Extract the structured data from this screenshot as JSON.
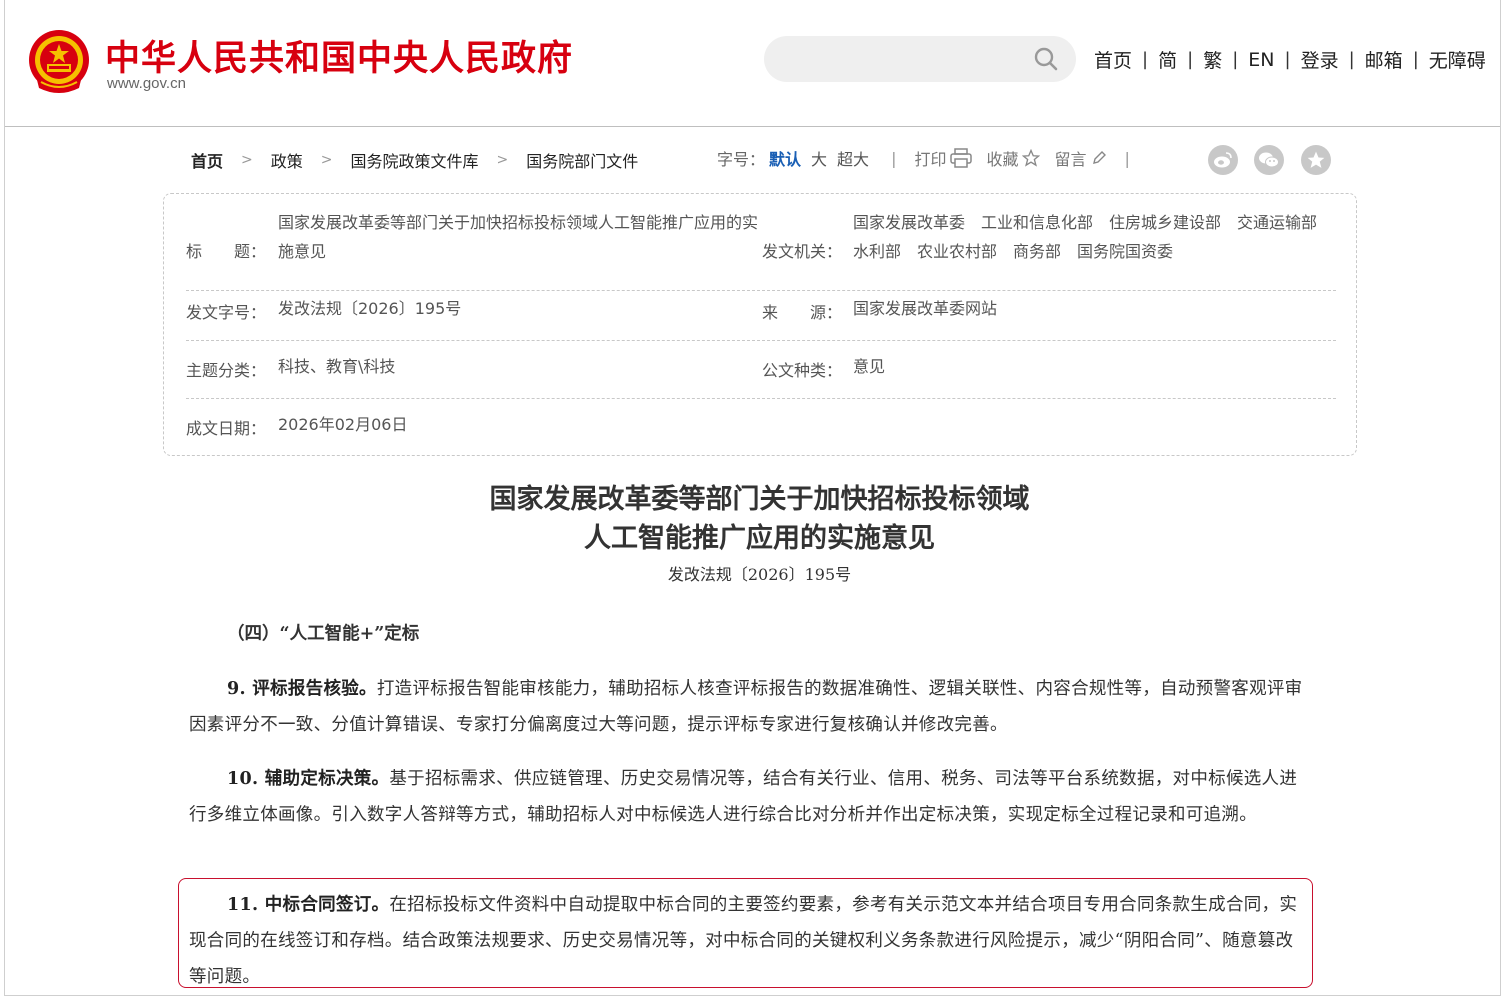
{
  "header": {
    "site_title": "中华人民共和国中央人民政府",
    "site_domain": "www.gov.cn",
    "search_placeholder": "",
    "nav": [
      "首页",
      "简",
      "繁",
      "EN",
      "登录",
      "邮箱",
      "无障碍"
    ],
    "colors": {
      "brand_red": "#d7000f",
      "link_blue": "#1a5fb4",
      "highlight_border": "#c8102e"
    }
  },
  "breadcrumb": [
    "首页",
    "政策",
    "国务院政策文件库",
    "国务院部门文件"
  ],
  "tools": {
    "font_size_label": "字号：",
    "font_sizes": [
      "默认",
      "大",
      "超大"
    ],
    "active_font_size": "默认",
    "print": "打印",
    "favorite": "收藏",
    "comment": "留言",
    "share_icons": [
      "weibo-icon",
      "wechat-icon",
      "qzone-icon"
    ]
  },
  "info": {
    "title_label": "标　　题：",
    "title_value": "国家发展改革委等部门关于加快招标投标领域人工智能推广应用的实施意见",
    "issuer_label": "发文机关：",
    "issuer_value": "国家发展改革委　工业和信息化部　住房城乡建设部　交通运输部　水利部　农业农村部　商务部　国务院国资委",
    "doc_no_label": "发文字号：",
    "doc_no_value": "发改法规〔2026〕195号",
    "source_label": "来　　源：",
    "source_value": "国家发展改革委网站",
    "subject_label": "主题分类：",
    "subject_value": "科技、教育\\科技",
    "type_label": "公文种类：",
    "type_value": "意见",
    "date_label": "成文日期：",
    "date_value": "2026年02月06日"
  },
  "article": {
    "title_line1": "国家发展改革委等部门关于加快招标投标领域",
    "title_line2": "人工智能推广应用的实施意见",
    "doc_no": "发改法规〔2026〕195号",
    "section": "（四）“人工智能+”定标",
    "p9_head": "9. 评标报告核验。",
    "p9_body": "打造评标报告智能审核能力，辅助招标人核查评标报告的数据准确性、逻辑关联性、内容合规性等，自动预警客观评审因素评分不一致、分值计算错误、专家打分偏离度过大等问题，提示评标专家进行复核确认并修改完善。",
    "p10_head": "10. 辅助定标决策。",
    "p10_body": "基于招标需求、供应链管理、历史交易情况等，结合有关行业、信用、税务、司法等平台系统数据，对中标候选人进行多维立体画像。引入数字人答辩等方式，辅助招标人对中标候选人进行综合比对分析并作出定标决策，实现定标全过程记录和可追溯。",
    "p11_head": "11. 中标合同签订。",
    "p11_body": "在招标投标文件资料中自动提取中标合同的主要签约要素，参考有关示范文本并结合项目专用合同条款生成合同，实现合同的在线签订和存档。结合政策法规要求、历史交易情况等，对中标合同的关键权利义务条款进行风险提示，减少“阴阳合同”、随意篡改等问题。"
  }
}
